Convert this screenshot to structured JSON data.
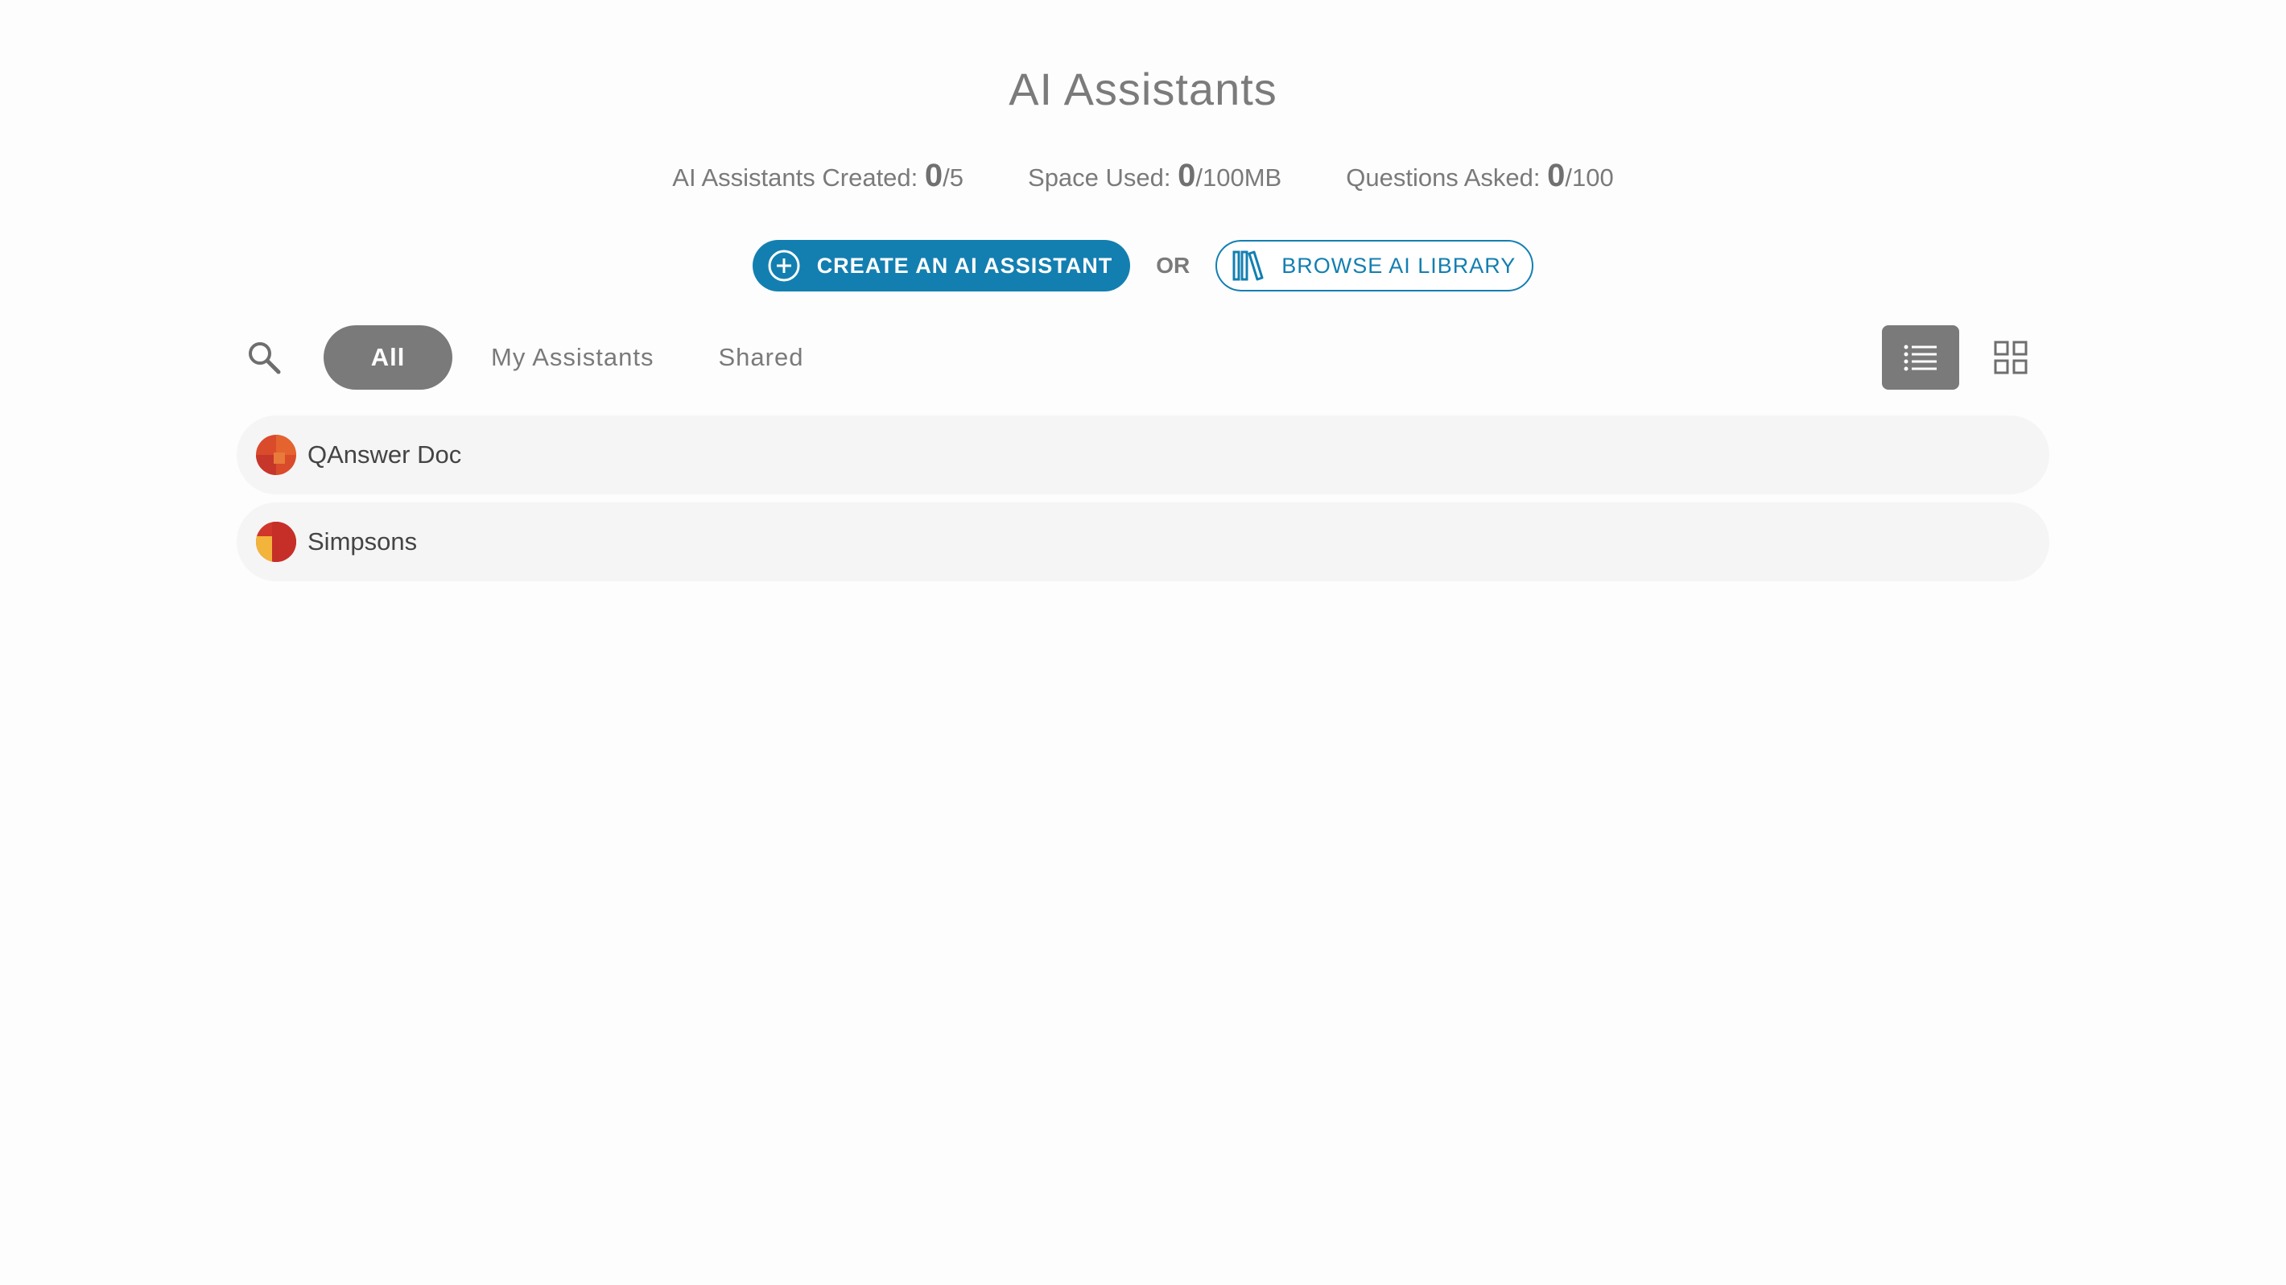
{
  "header": {
    "title": "AI Assistants"
  },
  "stats": {
    "created_label": "AI Assistants Created:",
    "created_value": "0",
    "created_max": "/5",
    "space_label": "Space Used:",
    "space_value": "0",
    "space_max": "/100MB",
    "questions_label": "Questions Asked:",
    "questions_value": "0",
    "questions_max": "/100"
  },
  "actions": {
    "create_label": "CREATE AN AI ASSISTANT",
    "or_label": "OR",
    "browse_label": "BROWSE AI LIBRARY"
  },
  "tabs": [
    {
      "label": "All",
      "active": true
    },
    {
      "label": "My Assistants",
      "active": false
    },
    {
      "label": "Shared",
      "active": false
    }
  ],
  "view": {
    "active": "list"
  },
  "assistants": [
    {
      "name": "QAnswer Doc"
    },
    {
      "name": "Simpsons"
    }
  ],
  "colors": {
    "accent": "#137fb1",
    "tab_active_bg": "#7a7a7a",
    "row_bg": "#f5f5f5"
  },
  "icons": {
    "search": "search-icon",
    "create": "add-circle-icon",
    "browse": "library-icon",
    "list_view": "list-view-icon",
    "grid_view": "grid-view-icon"
  }
}
